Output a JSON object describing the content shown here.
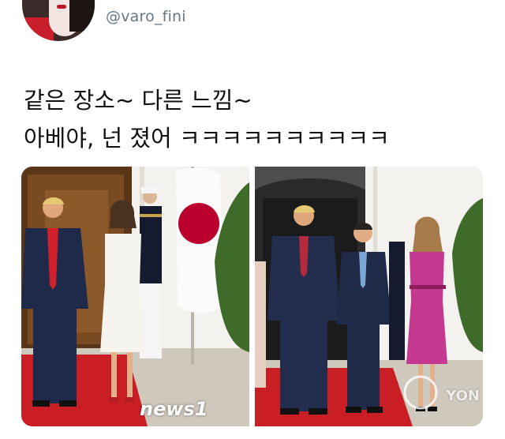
{
  "tweet": {
    "handle": "@varo_fini",
    "text_line1": "같은 장소~ 다른 느낌~",
    "text_line2": "아베야, 넌 졌어 ㅋㅋㅋㅋㅋㅋㅋㅋㅋㅋ"
  },
  "media": {
    "left_watermark": "news1",
    "right_watermark": "YON"
  },
  "colors": {
    "handle": "#657786",
    "carpet": "#c81e24",
    "japan_flag_red": "#bc002d",
    "magenta_coat": "#c4398f"
  }
}
